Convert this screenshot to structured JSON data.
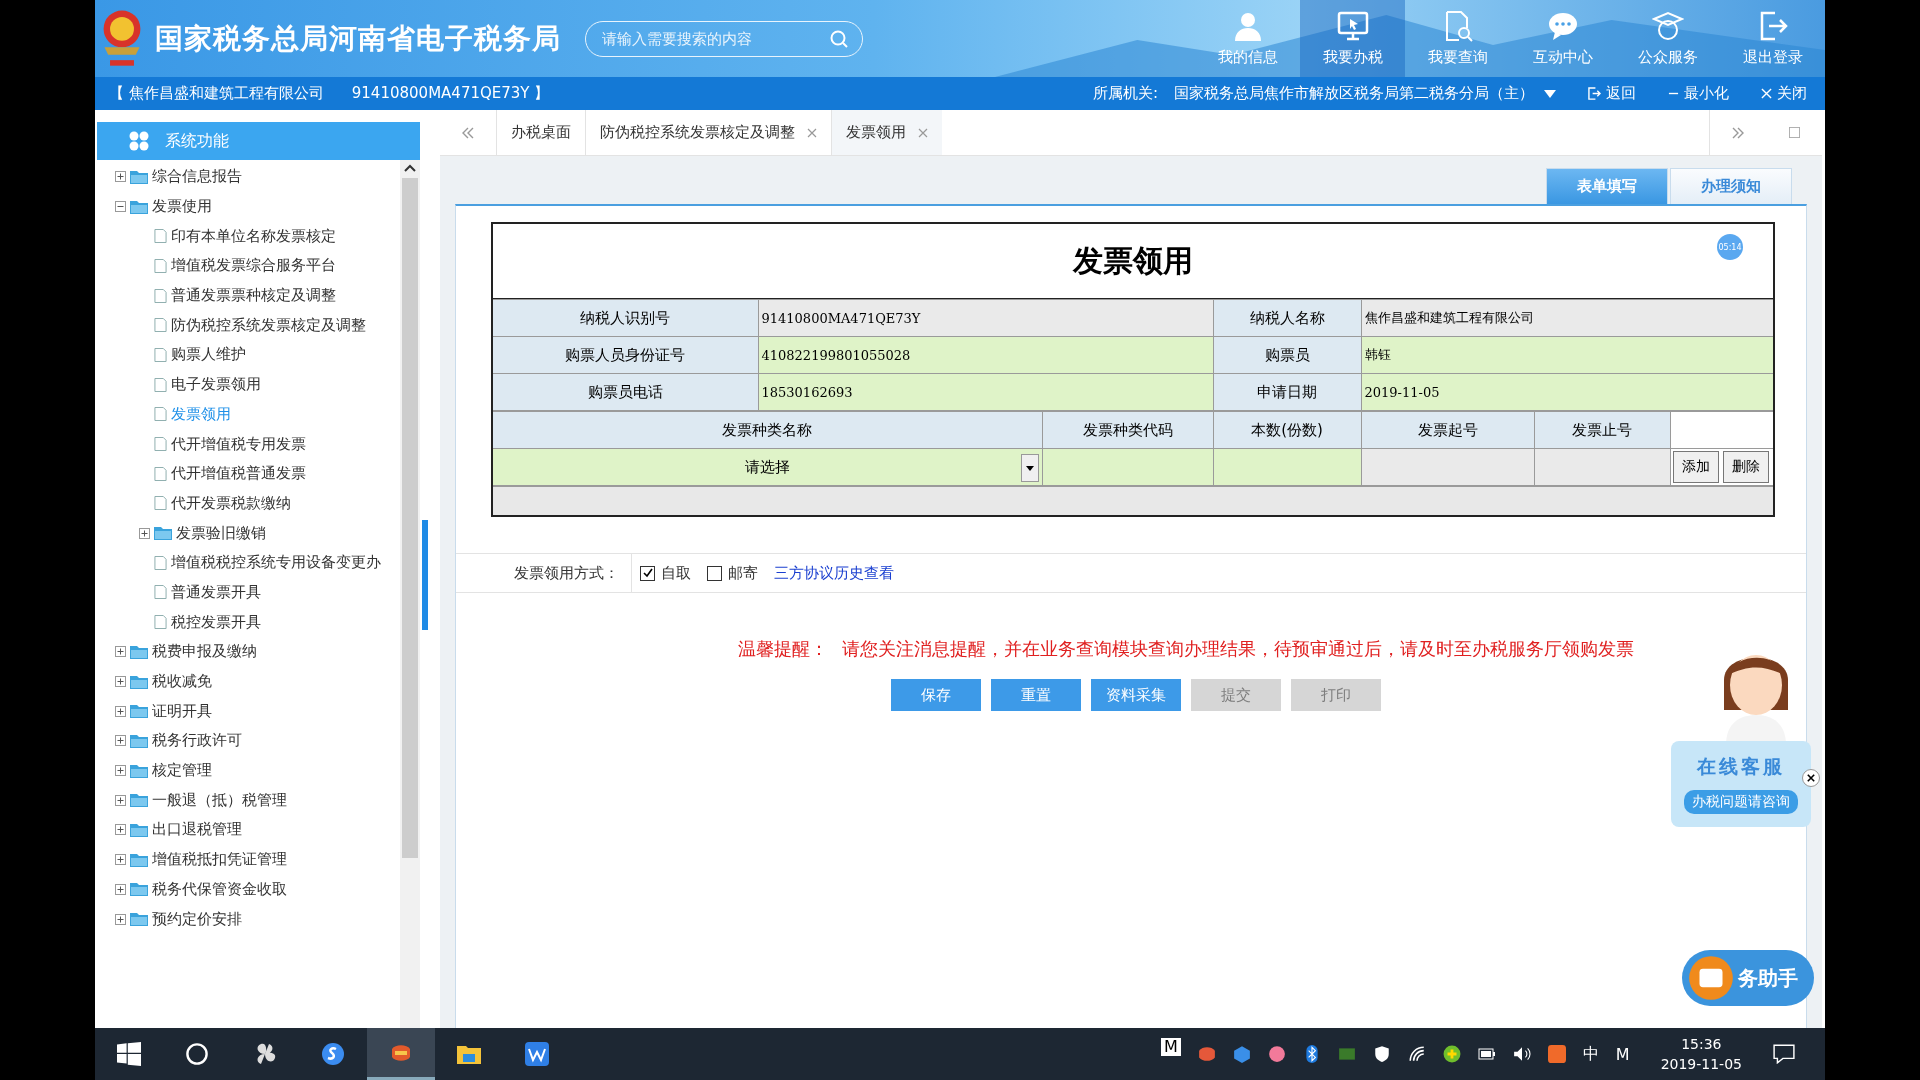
{
  "header": {
    "title": "国家税务总局河南省电子税务局",
    "search": {
      "placeholder": "请输入需要搜索的内容"
    },
    "nav": [
      {
        "label": "我的信息",
        "selected": false
      },
      {
        "label": "我要办税",
        "selected": true
      },
      {
        "label": "我要查询",
        "selected": false
      },
      {
        "label": "互动中心",
        "selected": false
      },
      {
        "label": "公众服务",
        "selected": false
      },
      {
        "label": "退出登录",
        "selected": false
      }
    ]
  },
  "company_bar": {
    "company": "【 焦作昌盛和建筑工程有限公司",
    "tax_id": "91410800MA471QE73Y 】",
    "authority_label": "所属机关:",
    "authority": "国家税务总局焦作市解放区税务局第二税务分局（主）",
    "actions": [
      {
        "label": "返回"
      },
      {
        "label": "最小化"
      },
      {
        "label": "关闭"
      }
    ]
  },
  "sidebar": {
    "title": "系统功能",
    "tree": [
      {
        "label": "综合信息报告",
        "kind": "folder",
        "expanded": false,
        "selected": false
      },
      {
        "label": "发票使用",
        "kind": "folder",
        "expanded": true,
        "selected": false,
        "children": [
          {
            "label": "印有本单位名称发票核定",
            "kind": "page",
            "selected": false
          },
          {
            "label": "增值税发票综合服务平台",
            "kind": "page",
            "selected": false
          },
          {
            "label": "普通发票票种核定及调整",
            "kind": "page",
            "selected": false
          },
          {
            "label": "防伪税控系统发票核定及调整",
            "kind": "page",
            "selected": false
          },
          {
            "label": "购票人维护",
            "kind": "page",
            "selected": false
          },
          {
            "label": "电子发票领用",
            "kind": "page",
            "selected": false
          },
          {
            "label": "发票领用",
            "kind": "page",
            "selected": true
          },
          {
            "label": "代开增值税专用发票",
            "kind": "page",
            "selected": false
          },
          {
            "label": "代开增值税普通发票",
            "kind": "page",
            "selected": false
          },
          {
            "label": "代开发票税款缴纳",
            "kind": "page",
            "selected": false
          },
          {
            "label": "发票验旧缴销",
            "kind": "folder",
            "expanded": false,
            "selected": false
          },
          {
            "label": "增值税税控系统专用设备变更办",
            "kind": "page",
            "selected": false
          },
          {
            "label": "普通发票开具",
            "kind": "page",
            "selected": false
          },
          {
            "label": "税控发票开具",
            "kind": "page",
            "selected": false
          }
        ]
      },
      {
        "label": "税费申报及缴纳",
        "kind": "folder",
        "expanded": false,
        "selected": false
      },
      {
        "label": "税收减免",
        "kind": "folder",
        "expanded": false,
        "selected": false
      },
      {
        "label": "证明开具",
        "kind": "folder",
        "expanded": false,
        "selected": false
      },
      {
        "label": "税务行政许可",
        "kind": "folder",
        "expanded": false,
        "selected": false
      },
      {
        "label": "核定管理",
        "kind": "folder",
        "expanded": false,
        "selected": false
      },
      {
        "label": "一般退（抵）税管理",
        "kind": "folder",
        "expanded": false,
        "selected": false
      },
      {
        "label": "出口退税管理",
        "kind": "folder",
        "expanded": false,
        "selected": false
      },
      {
        "label": "增值税抵扣凭证管理",
        "kind": "folder",
        "expanded": false,
        "selected": false
      },
      {
        "label": "税务代保管资金收取",
        "kind": "folder",
        "expanded": false,
        "selected": false
      },
      {
        "label": "预约定价安排",
        "kind": "folder",
        "expanded": false,
        "selected": false
      }
    ]
  },
  "tabs": [
    {
      "label": "办税桌面",
      "closable": false,
      "selected": false
    },
    {
      "label": "防伪税控系统发票核定及调整",
      "closable": true,
      "selected": false
    },
    {
      "label": "发票领用",
      "closable": true,
      "selected": true
    }
  ],
  "form_tabs": [
    {
      "label": "表单填写",
      "selected": true
    },
    {
      "label": "办理须知",
      "selected": false
    }
  ],
  "form": {
    "title": "发票领用",
    "timer": "05:14",
    "info_rows": [
      {
        "label": "纳税人识别号",
        "value": "91410800MA471QE73Y",
        "label2": "纳税人名称",
        "value2": "焦作昌盛和建筑工程有限公司",
        "editable": false
      },
      {
        "label": "购票人员身份证号",
        "value": "410822199801055028",
        "label2": "购票员",
        "value2": "韩钰",
        "editable": true
      },
      {
        "label": "购票员电话",
        "value": "18530162693",
        "label2": "申请日期",
        "value2": "2019-11-05",
        "editable": true
      }
    ],
    "invoice_columns": [
      "发票种类名称",
      "发票种类代码",
      "本数(份数)",
      "发票起号",
      "发票止号"
    ],
    "invoice_row": {
      "type": {
        "placeholder": "请选择"
      },
      "actions": [
        "添加",
        "删除"
      ]
    },
    "method": {
      "label": "发票领用方式：",
      "options": [
        {
          "label": "自取",
          "checked": true
        },
        {
          "label": "邮寄",
          "checked": false
        }
      ],
      "link": "三方协议历史查看"
    },
    "reminder": {
      "label": "温馨提醒：",
      "text": "请您关注消息提醒，并在业务查询模块查询办理结果，待预审通过后，请及时至办税服务厅领购发票"
    },
    "buttons": [
      {
        "label": "保存",
        "disabled": false
      },
      {
        "label": "重置",
        "disabled": false
      },
      {
        "label": "资料采集",
        "disabled": false
      },
      {
        "label": "提交",
        "disabled": true
      },
      {
        "label": "打印",
        "disabled": true
      }
    ]
  },
  "support": {
    "title": "在线客服",
    "subtitle": "办税问题请咨询"
  },
  "assistant": {
    "label": "务助手"
  },
  "taskbar": {
    "tray_texts": [
      "M",
      "中",
      "M"
    ],
    "time": "15:36",
    "date": "2019-11-05"
  }
}
